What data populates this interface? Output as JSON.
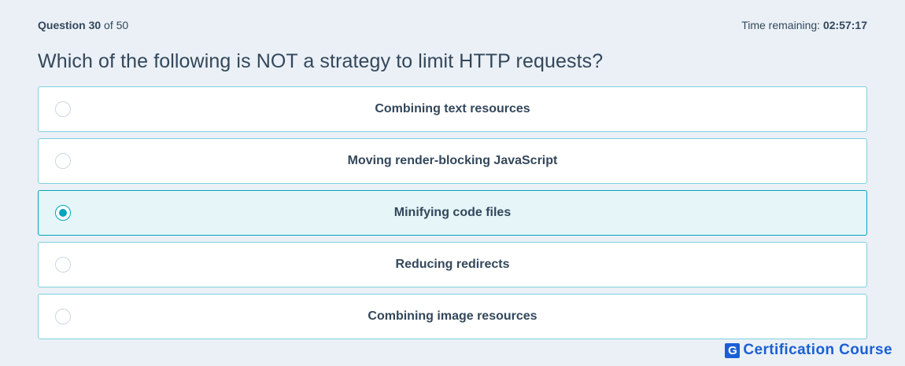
{
  "header": {
    "question_label": "Question",
    "question_number": "30",
    "question_of": "of 50",
    "time_label": "Time remaining:",
    "time_value": "02:57:17"
  },
  "question": {
    "text": "Which of the following is NOT a strategy to limit HTTP requests?"
  },
  "options": [
    {
      "label": "Combining text resources",
      "selected": false
    },
    {
      "label": "Moving render-blocking JavaScript",
      "selected": false
    },
    {
      "label": "Minifying code files",
      "selected": true
    },
    {
      "label": "Reducing redirects",
      "selected": false
    },
    {
      "label": "Combining image resources",
      "selected": false
    }
  ],
  "brand": {
    "logo_letter": "G",
    "text": "Certification Course",
    "color": "#1a5fd6"
  },
  "colors": {
    "accent": "#00a4bd",
    "border": "#7fd1de",
    "selected_bg": "#e5f5f8",
    "page_bg": "#eaf0f6",
    "text": "#33475b"
  }
}
